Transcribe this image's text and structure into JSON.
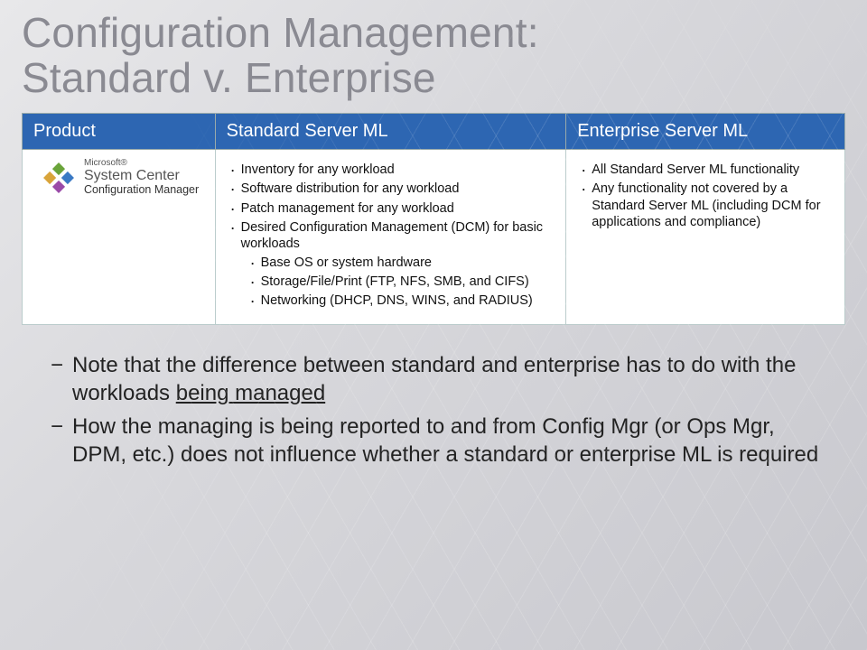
{
  "slide": {
    "title_line1": "Configuration Management:",
    "title_line2": "Standard v. Enterprise"
  },
  "table": {
    "headers": {
      "product": "Product",
      "standard": "Standard Server ML",
      "enterprise": "Enterprise Server ML"
    },
    "product_logo": {
      "vendor": "Microsoft®",
      "brand": "System Center",
      "product": "Configuration Manager"
    },
    "standard": {
      "items": [
        "Inventory for any workload",
        "Software distribution for any workload",
        "Patch management for any workload",
        "Desired Configuration Management (DCM) for basic workloads"
      ],
      "dcm_sub": [
        "Base OS or system hardware",
        "Storage/File/Print (FTP, NFS, SMB, and CIFS)",
        "Networking (DHCP, DNS, WINS, and RADIUS)"
      ]
    },
    "enterprise": {
      "items": [
        "All Standard Server ML functionality",
        "Any functionality not covered by a Standard Server ML (including DCM for applications and compliance)"
      ]
    }
  },
  "notes": {
    "n1_a": "Note that the difference between standard and enterprise has to do with the workloads ",
    "n1_u": "being managed",
    "n2": "How the managing is being reported to and from Config Mgr (or Ops Mgr, DPM, etc.) does not influence whether a standard or enterprise ML is required"
  }
}
